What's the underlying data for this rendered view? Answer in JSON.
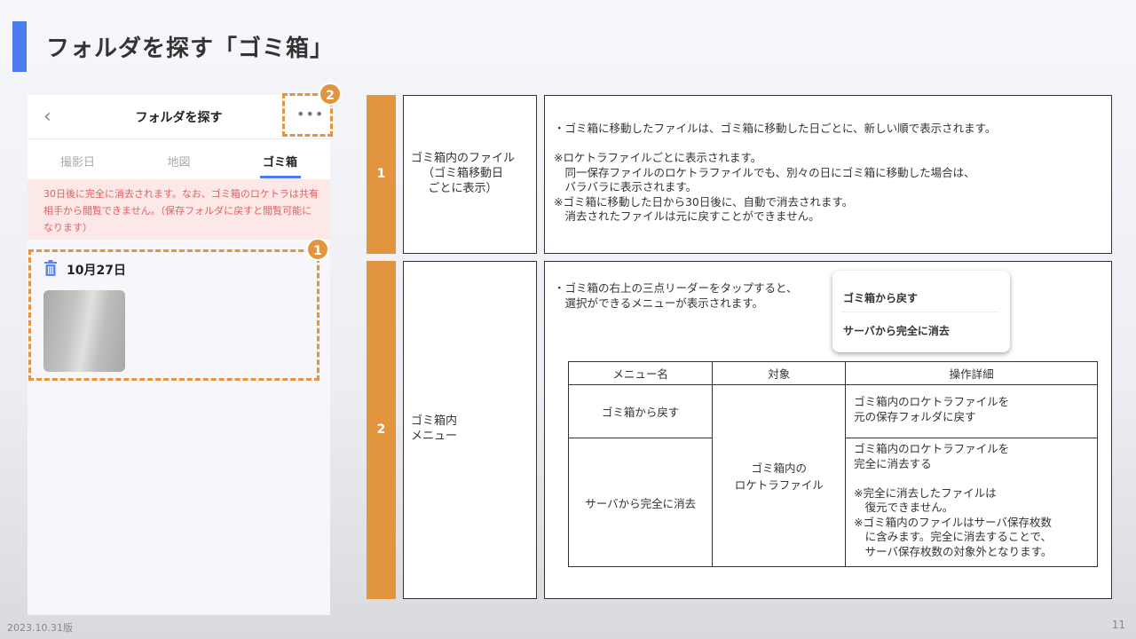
{
  "page": {
    "title": "フォルダを探す「ゴミ箱」",
    "footer_date": "2023.10.31版",
    "page_number": "11"
  },
  "phone": {
    "back_icon": "chevron-left-icon",
    "title": "フォルダを探す",
    "more_icon": "more-dots-icon",
    "tabs": [
      {
        "label": "撮影日",
        "active": false
      },
      {
        "label": "地図",
        "active": false
      },
      {
        "label": "ゴミ箱",
        "active": true
      }
    ],
    "notice": "30日後に完全に消去されます。なお、ゴミ箱のロケトラは共有相手から閲覧できません。（保存フォルダに戻すと閲覧可能になります）",
    "date_group": "10月27日",
    "trash_icon": "trash-icon"
  },
  "callouts": [
    "1",
    "2"
  ],
  "rows": [
    {
      "number": "1",
      "label": "ゴミ箱内のファイル\n（ゴミ箱移動日\nごとに表示）",
      "description": "・ゴミ箱に移動したファイルは、ゴミ箱に移動した日ごとに、新しい順で表示されます。\n\n※ロケトラファイルごとに表示されます。\n　同一保存ファイルのロケトラファイルでも、別々の日にゴミ箱に移動した場合は、\n　バラバラに表示されます。\n※ゴミ箱に移動した日から30日後に、自動で消去されます。\n　消去されたファイルは元に戻すことができません。"
    },
    {
      "number": "2",
      "label": "ゴミ箱内\nメニュー",
      "description": "・ゴミ箱の右上の三点リーダーをタップすると、\n　選択ができるメニューが表示されます。",
      "menu_popup": [
        "ゴミ箱から戻す",
        "サーバから完全に消去"
      ],
      "table": {
        "headers": [
          "メニュー名",
          "対象",
          "操作詳細"
        ],
        "target": "ゴミ箱内の\nロケトラファイル",
        "rows": [
          {
            "menu": "ゴミ箱から戻す",
            "detail": "ゴミ箱内のロケトラファイルを\n元の保存フォルダに戻す"
          },
          {
            "menu": "サーバから完全に消去",
            "detail": "ゴミ箱内のロケトラファイルを\n完全に消去する\n\n※完全に消去したファイルは\n　復元できません。\n※ゴミ箱内のファイルはサーバ保存枚数\n　に含みます。完全に消去することで、\n　サーバ保存枚数の対象外となります。"
          }
        ]
      }
    }
  ],
  "colors": {
    "accent": "#4a7cf0",
    "callout": "#e1953f",
    "notice_bg": "#fde8e8",
    "notice_text": "#e06060"
  }
}
